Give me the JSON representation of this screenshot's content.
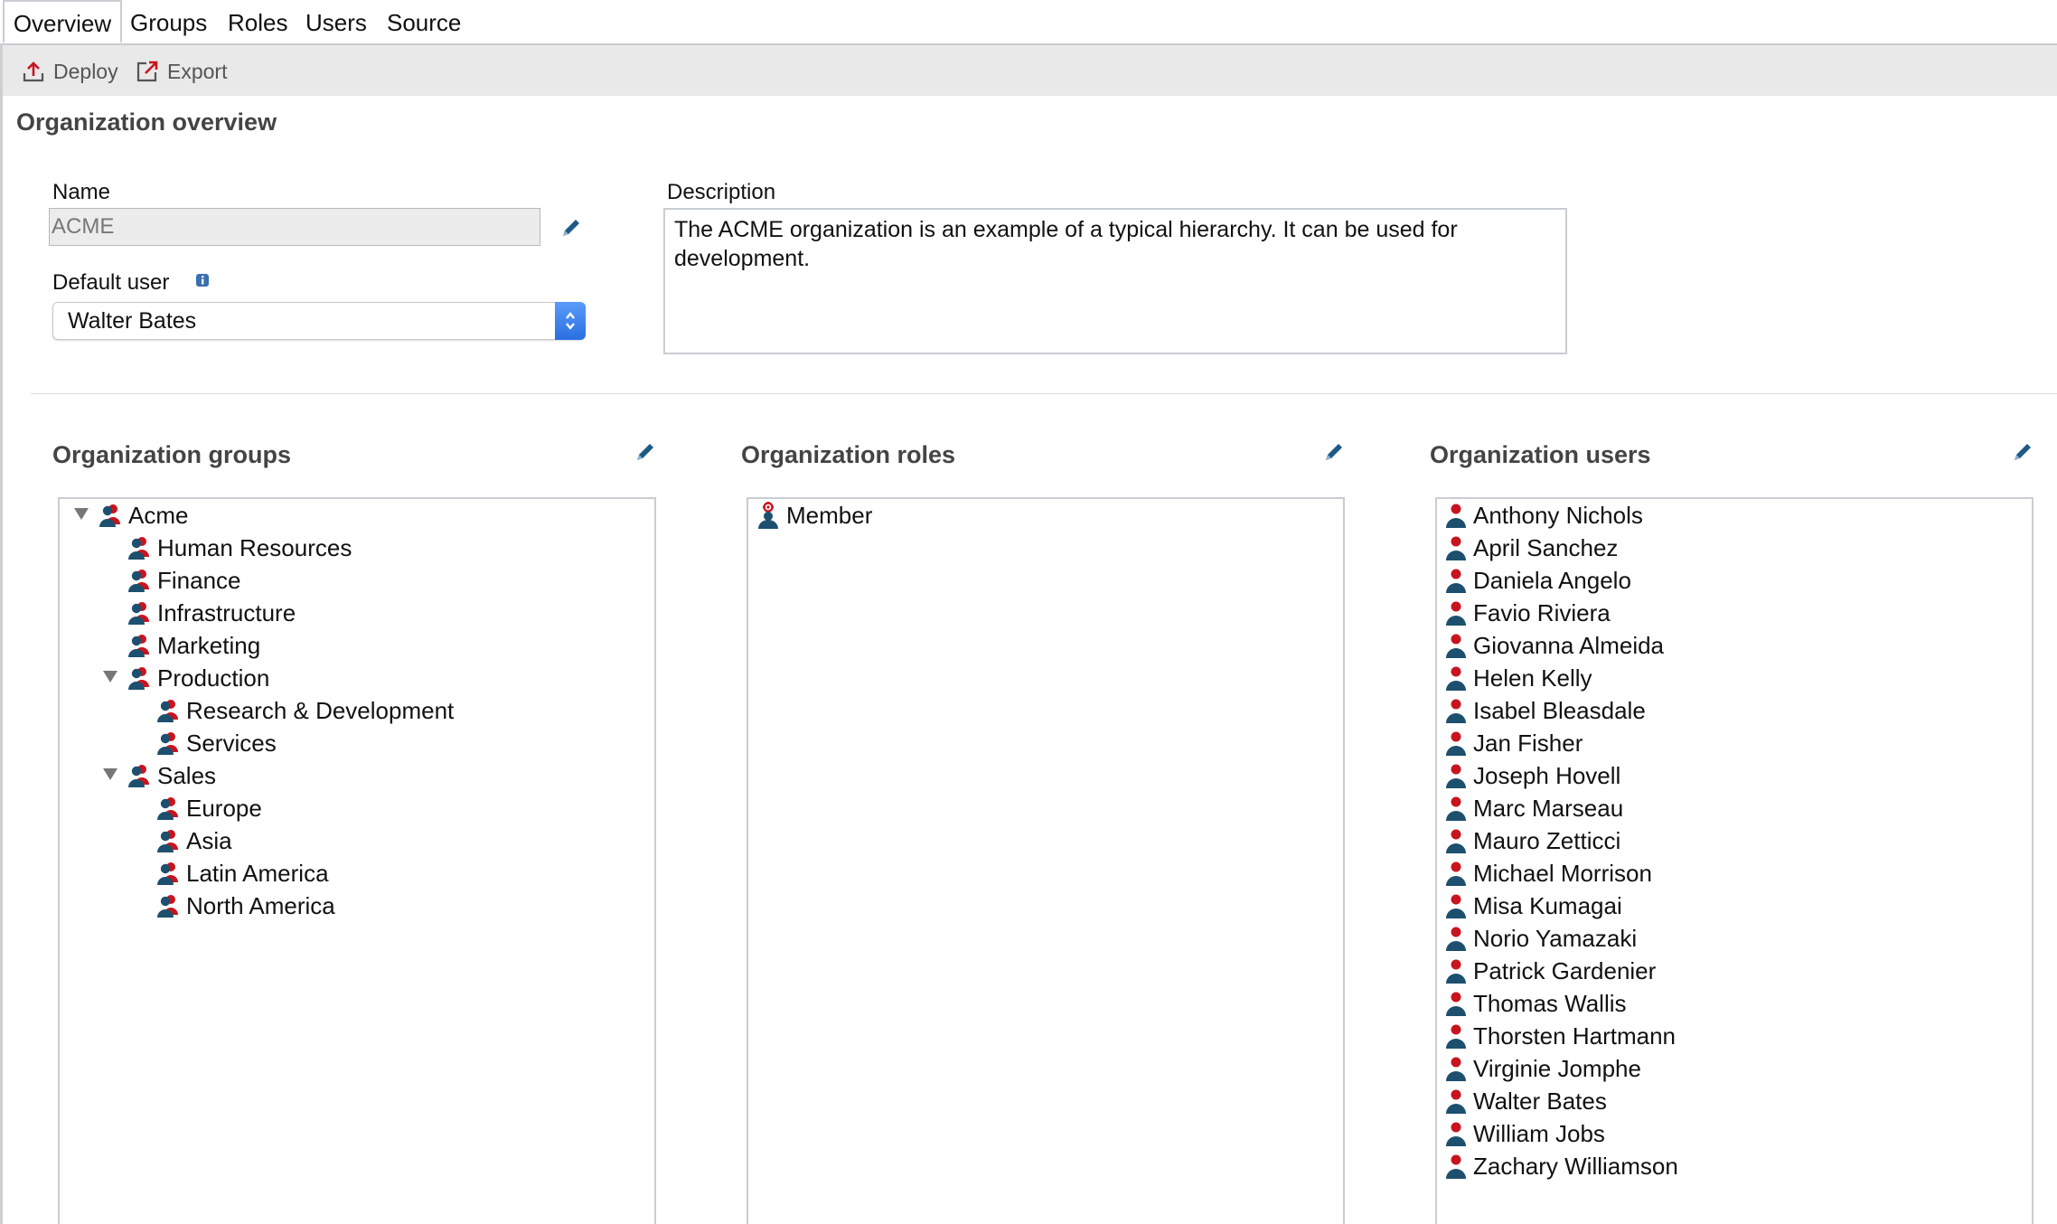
{
  "tabs": [
    "Overview",
    "Groups",
    "Roles",
    "Users",
    "Source"
  ],
  "toolbar": {
    "deploy": "Deploy",
    "export": "Export"
  },
  "overview": {
    "title": "Organization overview",
    "name_label": "Name",
    "name_value": "ACME",
    "default_user_label": "Default user",
    "default_user_value": "Walter Bates",
    "description_label": "Description",
    "description": "The ACME organization is an example of a typical hierarchy. It can be used for development."
  },
  "groups": {
    "title": "Organization groups",
    "items": [
      "Acme",
      "Human Resources",
      "Finance",
      "Infrastructure",
      "Marketing",
      "Production",
      "Research & Development",
      "Services",
      "Sales",
      "Europe",
      "Asia",
      "Latin America",
      "North America"
    ]
  },
  "roles": {
    "title": "Organization roles",
    "items": [
      "Member"
    ]
  },
  "users": {
    "title": "Organization users",
    "items": [
      "Anthony Nichols",
      "April Sanchez",
      "Daniela Angelo",
      "Favio Riviera",
      "Giovanna Almeida",
      "Helen Kelly",
      "Isabel Bleasdale",
      "Jan Fisher",
      "Joseph Hovell",
      "Marc Marseau",
      "Mauro Zetticci",
      "Michael Morrison",
      "Misa Kumagai",
      "Norio Yamazaki",
      "Patrick Gardenier",
      "Thomas Wallis",
      "Thorsten Hartmann",
      "Virginie Jomphe",
      "Walter Bates",
      "William Jobs",
      "Zachary Williamson"
    ]
  },
  "colors": {
    "accent_blue": "#2a6fe0",
    "icon_dark": "#1d4f6e",
    "icon_red": "#c8141e"
  }
}
